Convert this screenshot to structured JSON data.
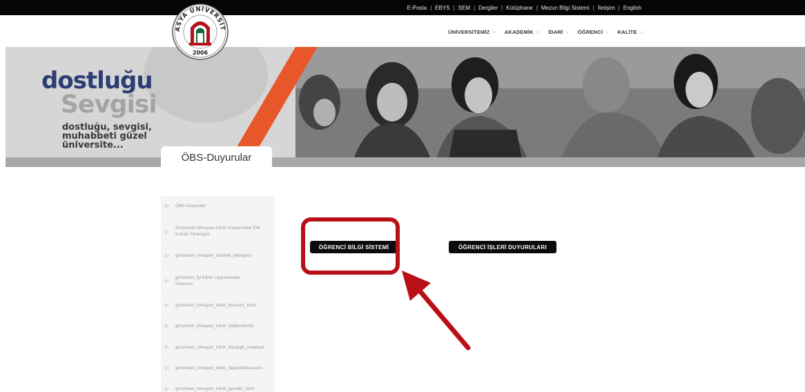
{
  "topbar": {
    "links": [
      "E-Posta",
      "EBYS",
      "SEM",
      "Dergiler",
      "Kütüphane",
      "Mezun Bilgi Sistemi",
      "İletişim",
      "English"
    ]
  },
  "logo": {
    "text_top": "AMASYA ÜNİVERSİTESİ",
    "year": "2006"
  },
  "mainnav": {
    "items": [
      "ÜNİVERSİTEMİZ",
      "AKADEMİK",
      "İDARİ",
      "ÖĞRENCİ",
      "KALİTE"
    ]
  },
  "banner": {
    "slogan_line1": "dostluğu",
    "slogan_line2": "Sevgisi",
    "slogan_line3": "dostluğu, sevgisi, muhabbeti güzel üniversite..."
  },
  "page_tab": {
    "title": "ÖBS-Duyurular"
  },
  "sidebar": {
    "items": [
      "ÖBS-Duyurular",
      "Girişimsel Olmayan Klinik Araştırmalar Etik Kurulu Yönergesi",
      "girisimsel_olmayan_helsinki_bildirgesi",
      "girisimsel_İyi Klinik Uygulamaları Kılavuzu",
      "girisimsel_olmayan_klinik_basvuru_form",
      "girisimsel_olmayan_klinik_bilgilendirme",
      "girisimsel_olmayan_klinik_biyolojik_materyal",
      "girisimsel_olmayan_klinik_degisiklikbasvuru",
      "girisimsel_olmayan_klinik_gonullu_form"
    ]
  },
  "main": {
    "obs_button": "ÖĞRENCİ BİLGİ SİSTEMİ",
    "duyuru_button": "ÖĞRENCİ İŞLERİ DUYURULARI"
  },
  "colors": {
    "accent_red": "#b90f16",
    "banner_orange": "#e8572a",
    "logo_red": "#b5121b",
    "logo_green": "#0f6b3a",
    "navy": "#2c3e72"
  }
}
